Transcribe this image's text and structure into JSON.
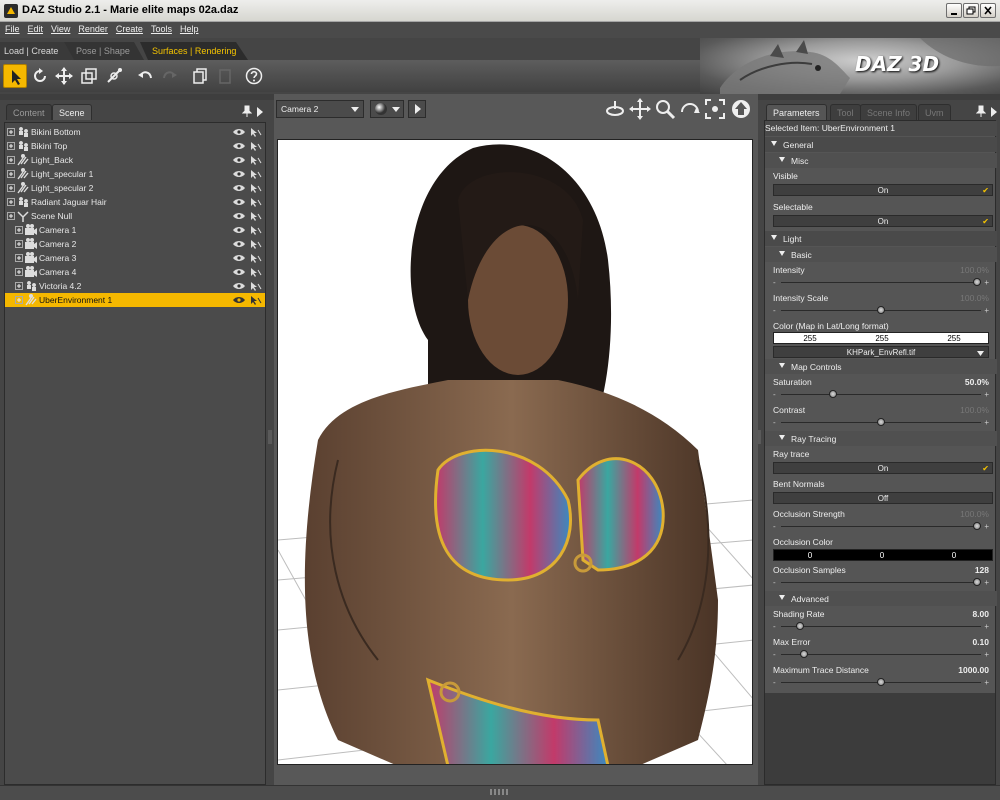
{
  "window": {
    "title": "DAZ Studio 2.1  - Marie elite maps 02a.daz"
  },
  "menu": [
    "File",
    "Edit",
    "View",
    "Render",
    "Create",
    "Tools",
    "Help"
  ],
  "layout_tabs": [
    {
      "label": "Load | Create",
      "active": false
    },
    {
      "label": "Pose | Shape",
      "active": false
    },
    {
      "label": "Surfaces | Rendering",
      "active": true
    }
  ],
  "toolbar_icons": [
    "select-arrow-icon",
    "rotate-icon",
    "translate-icon",
    "scale-icon",
    "joint-editor-icon",
    "undo-icon",
    "redo-icon",
    "copy-icon",
    "paste-icon",
    "help-icon"
  ],
  "banner": {
    "logo": "DAZ 3D"
  },
  "left_panel": {
    "tabs": [
      "Content",
      "Scene"
    ],
    "active_tab": "Scene",
    "nodes": [
      {
        "label": "Bikini Bottom",
        "depth": 0,
        "icon": "figure-icon",
        "selected": false
      },
      {
        "label": "Bikini Top",
        "depth": 0,
        "icon": "figure-icon",
        "selected": false
      },
      {
        "label": "Light_Back",
        "depth": 0,
        "icon": "light-icon",
        "selected": false
      },
      {
        "label": "Light_specular 1",
        "depth": 0,
        "icon": "light-icon",
        "selected": false
      },
      {
        "label": "Light_specular 2",
        "depth": 0,
        "icon": "light-icon",
        "selected": false
      },
      {
        "label": "Radiant Jaguar Hair",
        "depth": 0,
        "icon": "figure-icon",
        "selected": false
      },
      {
        "label": "Scene Null",
        "depth": 0,
        "icon": "null-icon",
        "selected": false
      },
      {
        "label": "Camera 1",
        "depth": 1,
        "icon": "camera-icon",
        "selected": false
      },
      {
        "label": "Camera 2",
        "depth": 1,
        "icon": "camera-icon",
        "selected": false
      },
      {
        "label": "Camera 3",
        "depth": 1,
        "icon": "camera-icon",
        "selected": false
      },
      {
        "label": "Camera 4",
        "depth": 1,
        "icon": "camera-icon",
        "selected": false
      },
      {
        "label": "Victoria 4.2",
        "depth": 1,
        "icon": "figure-icon",
        "selected": false
      },
      {
        "label": "UberEnvironment 1",
        "depth": 1,
        "icon": "light-icon",
        "selected": true
      }
    ]
  },
  "viewport": {
    "camera": "Camera 2",
    "nav_icons": [
      "orbit-icon",
      "pan-icon",
      "zoom-icon",
      "roll-icon",
      "frame-icon",
      "home-icon"
    ]
  },
  "right_panel": {
    "tabs": [
      "Parameters",
      "Tool",
      "Scene Info",
      "Uvm"
    ],
    "active_tab": "Parameters",
    "selected_item": "Selected Item: UberEnvironment 1",
    "sections": {
      "general": "General",
      "misc": "Misc",
      "light": "Light",
      "basic": "Basic",
      "map_controls": "Map Controls",
      "ray_tracing": "Ray Tracing",
      "advanced": "Advanced"
    },
    "params": {
      "visible": {
        "label": "Visible",
        "value": "On"
      },
      "selectable": {
        "label": "Selectable",
        "value": "On"
      },
      "intensity": {
        "label": "Intensity",
        "value": "100.0%",
        "fraction": 1.0
      },
      "intensity_scale": {
        "label": "Intensity Scale",
        "value": "100.0%",
        "fraction": 0.5
      },
      "color": {
        "label": "Color (Map in Lat/Long format)",
        "r": "255",
        "g": "255",
        "b": "255",
        "map": "KHPark_EnvRefl.tif"
      },
      "saturation": {
        "label": "Saturation",
        "value": "50.0%",
        "fraction": 0.25
      },
      "contrast": {
        "label": "Contrast",
        "value": "100.0%",
        "fraction": 0.5
      },
      "ray_trace": {
        "label": "Ray trace",
        "value": "On"
      },
      "bent_normals": {
        "label": "Bent Normals",
        "value": "Off"
      },
      "occlusion_strength": {
        "label": "Occlusion Strength",
        "value": "100.0%",
        "fraction": 1.0
      },
      "occlusion_color": {
        "label": "Occlusion Color",
        "r": "0",
        "g": "0",
        "b": "0"
      },
      "occlusion_samples": {
        "label": "Occlusion Samples",
        "value": "128",
        "fraction": 1.0
      },
      "shading_rate": {
        "label": "Shading Rate",
        "value": "8.00",
        "fraction": 0.08
      },
      "max_error": {
        "label": "Max Error",
        "value": "0.10",
        "fraction": 0.1
      },
      "max_trace_distance": {
        "label": "Maximum Trace Distance",
        "value": "1000.00",
        "fraction": 0.5
      }
    }
  },
  "colors": {
    "accent": "#f5b800",
    "panel": "#555555",
    "selection": "#f5b800"
  }
}
